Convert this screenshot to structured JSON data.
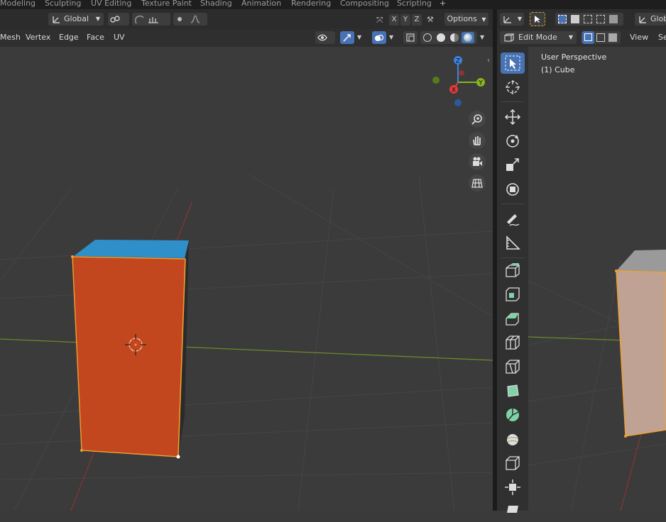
{
  "workspace_tabs": [
    "Modeling",
    "Sculpting",
    "UV Editing",
    "Texture Paint",
    "Shading",
    "Animation",
    "Rendering",
    "Compositing",
    "Scripting",
    "+"
  ],
  "left_header": {
    "orientation": "Global",
    "options_label": "Options",
    "axis_x": "X",
    "axis_y": "Y",
    "axis_z": "Z"
  },
  "left_menu": [
    "Mesh",
    "Vertex",
    "Edge",
    "Face",
    "UV"
  ],
  "right_header": {
    "mode": "Edit Mode",
    "view_menu": "View",
    "select_menu_partial": "Se",
    "orientation_partial": "Glob"
  },
  "gizmo": {
    "x": "X",
    "y": "Y",
    "z": "Z"
  },
  "viewport_info": {
    "line1": "User Perspective",
    "line2": "(1) Cube"
  },
  "colors": {
    "selected_face": "#c2471f",
    "top_face": "#2e8fc9",
    "accent": "#4772b3",
    "x_axis": "#e03c3c",
    "y_axis": "#86b61c",
    "z_axis": "#3c84e0"
  },
  "icons": [
    "transform-orientation-icon",
    "snap-icon",
    "proportional-edit-icon",
    "xray-icon",
    "shading-solid-icon",
    "select-cursor-icon",
    "cursor-icon",
    "move-icon",
    "rotate-icon",
    "scale-icon",
    "transform-icon",
    "annotate-icon",
    "measure-icon",
    "extrude-icon",
    "inset-icon",
    "bevel-icon",
    "loop-cut-icon",
    "knife-icon",
    "poly-build-icon",
    "spin-icon",
    "smooth-icon",
    "edge-slide-icon",
    "shrink-fatten-icon",
    "zoom-icon",
    "hand-icon",
    "camera-icon",
    "grid-icon"
  ]
}
